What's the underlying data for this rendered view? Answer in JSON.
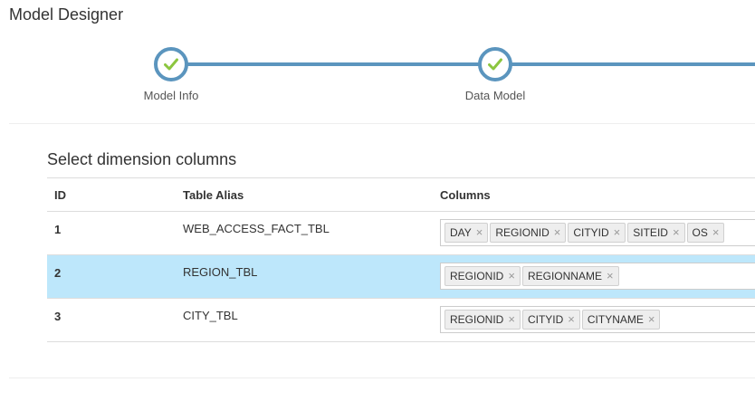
{
  "app": {
    "title": "Model Designer"
  },
  "wizard": {
    "steps": [
      {
        "label": "Model Info",
        "status": "complete"
      },
      {
        "label": "Data Model",
        "status": "complete"
      }
    ],
    "accent_color": "#5b95be",
    "check_color": "#8cc63f"
  },
  "section": {
    "title": "Select dimension columns"
  },
  "table": {
    "headers": {
      "id": "ID",
      "alias": "Table Alias",
      "columns": "Columns"
    },
    "rows": [
      {
        "id": "1",
        "alias": "WEB_ACCESS_FACT_TBL",
        "columns": [
          "DAY",
          "REGIONID",
          "CITYID",
          "SITEID",
          "OS"
        ],
        "selected": false
      },
      {
        "id": "2",
        "alias": "REGION_TBL",
        "columns": [
          "REGIONID",
          "REGIONNAME"
        ],
        "selected": true
      },
      {
        "id": "3",
        "alias": "CITY_TBL",
        "columns": [
          "REGIONID",
          "CITYID",
          "CITYNAME"
        ],
        "selected": false
      }
    ],
    "remove_glyph": "×",
    "selected_row_color": "#bde7fb"
  }
}
